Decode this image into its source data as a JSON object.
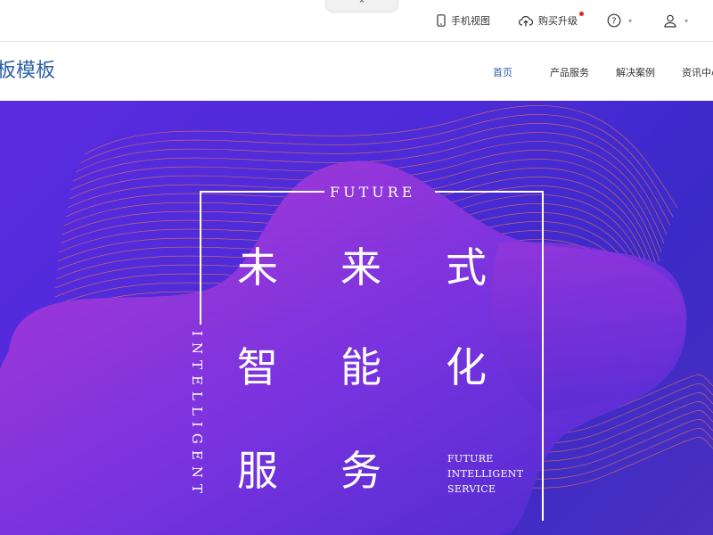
{
  "toolbar": {
    "collapse_glyph": "⌃",
    "mobile_view": "手机视图",
    "buy_upgrade": "购买升级",
    "help_icon_label": "?",
    "icons": [
      "phone-icon",
      "cloud-upload-icon",
      "help-icon",
      "user-icon"
    ]
  },
  "header": {
    "brand": "板模板",
    "nav": [
      "首页",
      "产品服务",
      "解决案例",
      "资讯中心"
    ]
  },
  "hero": {
    "future_top": "FUTURE",
    "vertical_text": "INTELLIGENT",
    "chars": {
      "c1": "未",
      "c2": "来",
      "c3": "式",
      "c4": "智",
      "c5": "能",
      "c6": "化",
      "c7": "服",
      "c8": "务"
    },
    "en_line1": "FUTURE",
    "en_line2": "INTELLIGENT",
    "en_line3": "SERVICE",
    "colors": {
      "bg": "#4d2bd8",
      "lines": "#f07a4a",
      "blob": "#a43ad8"
    }
  }
}
